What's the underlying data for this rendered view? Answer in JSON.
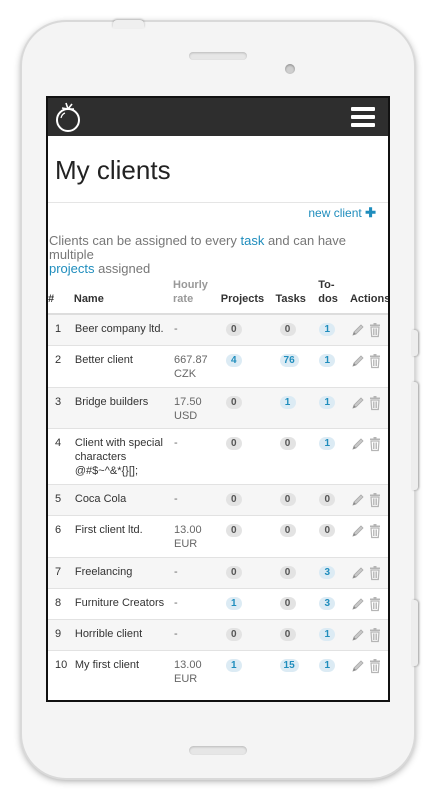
{
  "app": {
    "title": "My clients",
    "new_client_label": "new client",
    "new_client_icon": "plus-icon",
    "intro": {
      "part1": "Clients can be assigned to every ",
      "link_task": "task",
      "part2": " and can have multiple",
      "link_projects": "projects",
      "part3": " assigned"
    }
  },
  "table": {
    "headers": {
      "num": "#",
      "name": "Name",
      "rate_line1": "Hourly",
      "rate_line2": "rate",
      "projects": "Projects",
      "tasks": "Tasks",
      "todos_line1": "To-",
      "todos_line2": "dos",
      "actions": "Actions"
    },
    "rows": [
      {
        "num": "1",
        "name": "Beer company ltd.",
        "rate": "-",
        "projects": "0",
        "tasks": "0",
        "todos": "1"
      },
      {
        "num": "2",
        "name": "Better client",
        "rate": "667.87 CZK",
        "projects": "4",
        "tasks": "76",
        "todos": "1"
      },
      {
        "num": "3",
        "name": "Bridge builders",
        "rate": "17.50 USD",
        "projects": "0",
        "tasks": "1",
        "todos": "1"
      },
      {
        "num": "4",
        "name": "Client with special characters @#$~^&*{}[];",
        "rate": "-",
        "projects": "0",
        "tasks": "0",
        "todos": "1"
      },
      {
        "num": "5",
        "name": "Coca Cola",
        "rate": "-",
        "projects": "0",
        "tasks": "0",
        "todos": "0"
      },
      {
        "num": "6",
        "name": "First client ltd.",
        "rate": "13.00 EUR",
        "projects": "0",
        "tasks": "0",
        "todos": "0"
      },
      {
        "num": "7",
        "name": "Freelancing",
        "rate": "-",
        "projects": "0",
        "tasks": "0",
        "todos": "3"
      },
      {
        "num": "8",
        "name": "Furniture Creators",
        "rate": "-",
        "projects": "1",
        "tasks": "0",
        "todos": "3"
      },
      {
        "num": "9",
        "name": "Horrible client",
        "rate": "-",
        "projects": "0",
        "tasks": "0",
        "todos": "1"
      },
      {
        "num": "10",
        "name": "My first client",
        "rate": "13.00 EUR",
        "projects": "1",
        "tasks": "15",
        "todos": "1"
      }
    ],
    "row_actions": [
      "pencil-icon",
      "trash-icon"
    ]
  },
  "colors": {
    "accent": "#1f8dbd",
    "topbar": "#2e2e2e"
  }
}
